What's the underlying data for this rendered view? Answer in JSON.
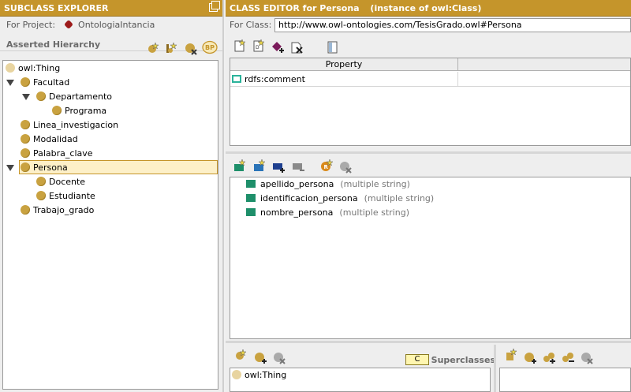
{
  "subclass_explorer": {
    "title": "SUBCLASS EXPLORER",
    "project_label": "For Project:",
    "project_name": "OntologiaIntancia",
    "hierarchy_label": "Asserted Hierarchy",
    "bp_badge": "BP",
    "tree": [
      {
        "label": "owl:Thing"
      },
      {
        "label": "Facultad"
      },
      {
        "label": "Departamento"
      },
      {
        "label": "Programa"
      },
      {
        "label": "Linea_investigacion"
      },
      {
        "label": "Modalidad"
      },
      {
        "label": "Palabra_clave"
      },
      {
        "label": "Persona",
        "selected": true
      },
      {
        "label": "Docente"
      },
      {
        "label": "Estudiante"
      },
      {
        "label": "Trabajo_grado"
      }
    ]
  },
  "class_editor": {
    "title": "CLASS EDITOR for Persona",
    "subtitle": "(instance of owl:Class)",
    "for_class_label": "For Class:",
    "for_class_value": "http://www.owl-ontologies.com/TesisGrado.owl#Persona",
    "property_table": {
      "columns": [
        "Property",
        ""
      ],
      "rows": [
        [
          "rdfs:comment",
          ""
        ]
      ]
    },
    "slots": [
      {
        "name": "apellido_persona",
        "type": "(multiple string)"
      },
      {
        "name": "identificacion_persona",
        "type": "(multiple string)"
      },
      {
        "name": "nombre_persona",
        "type": "(multiple string)"
      }
    ],
    "superclasses": {
      "tag": "C",
      "label": "Superclasses",
      "items": [
        "owl:Thing"
      ]
    }
  },
  "colors": {
    "title_bar": "#c5952b",
    "class_ball": "#c9a240",
    "slot_square": "#1e8f6a"
  }
}
